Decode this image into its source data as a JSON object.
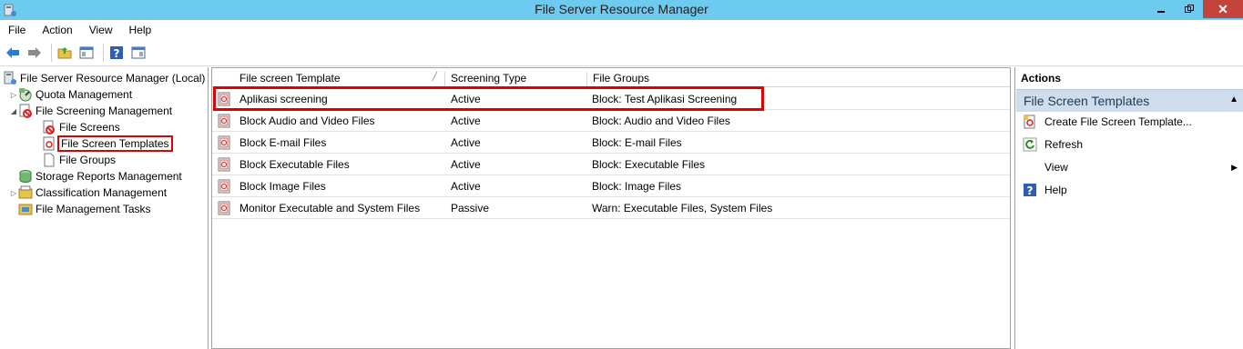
{
  "window": {
    "title": "File Server Resource Manager"
  },
  "menu": {
    "items": [
      "File",
      "Action",
      "View",
      "Help"
    ]
  },
  "tree": {
    "items": [
      {
        "label": "File Server Resource Manager (Local)",
        "icon": "server-icon"
      },
      {
        "label": "Quota Management",
        "icon": "quota-icon"
      },
      {
        "label": "File Screening Management",
        "icon": "screening-icon"
      },
      {
        "label": "File Screens",
        "icon": "file-screens-icon"
      },
      {
        "label": "File Screen Templates",
        "icon": "template-icon"
      },
      {
        "label": "File Groups",
        "icon": "file-groups-icon"
      },
      {
        "label": "Storage Reports Management",
        "icon": "reports-icon"
      },
      {
        "label": "Classification Management",
        "icon": "classification-icon"
      },
      {
        "label": "File Management Tasks",
        "icon": "tasks-icon"
      }
    ]
  },
  "list": {
    "columns": [
      "File screen Template",
      "Screening Type",
      "File Groups"
    ],
    "rows": [
      {
        "template": "Aplikasi screening",
        "type": "Active",
        "groups": "Block: Test Aplikasi Screening"
      },
      {
        "template": "Block Audio and Video Files",
        "type": "Active",
        "groups": "Block: Audio and Video Files"
      },
      {
        "template": "Block E-mail Files",
        "type": "Active",
        "groups": "Block: E-mail Files"
      },
      {
        "template": "Block Executable Files",
        "type": "Active",
        "groups": "Block: Executable Files"
      },
      {
        "template": "Block Image Files",
        "type": "Active",
        "groups": "Block: Image Files"
      },
      {
        "template": "Monitor Executable and System Files",
        "type": "Passive",
        "groups": "Warn: Executable Files, System Files"
      }
    ]
  },
  "actions": {
    "title": "Actions",
    "section": "File Screen Templates",
    "items": [
      {
        "label": "Create File Screen Template...",
        "icon": "create-template-icon"
      },
      {
        "label": "Refresh",
        "icon": "refresh-icon"
      },
      {
        "label": "View",
        "icon": ""
      },
      {
        "label": "Help",
        "icon": "help-icon"
      }
    ]
  },
  "colors": {
    "titlebar": "#6ccbef",
    "highlight": "#e00000",
    "close": "#c4443b"
  }
}
